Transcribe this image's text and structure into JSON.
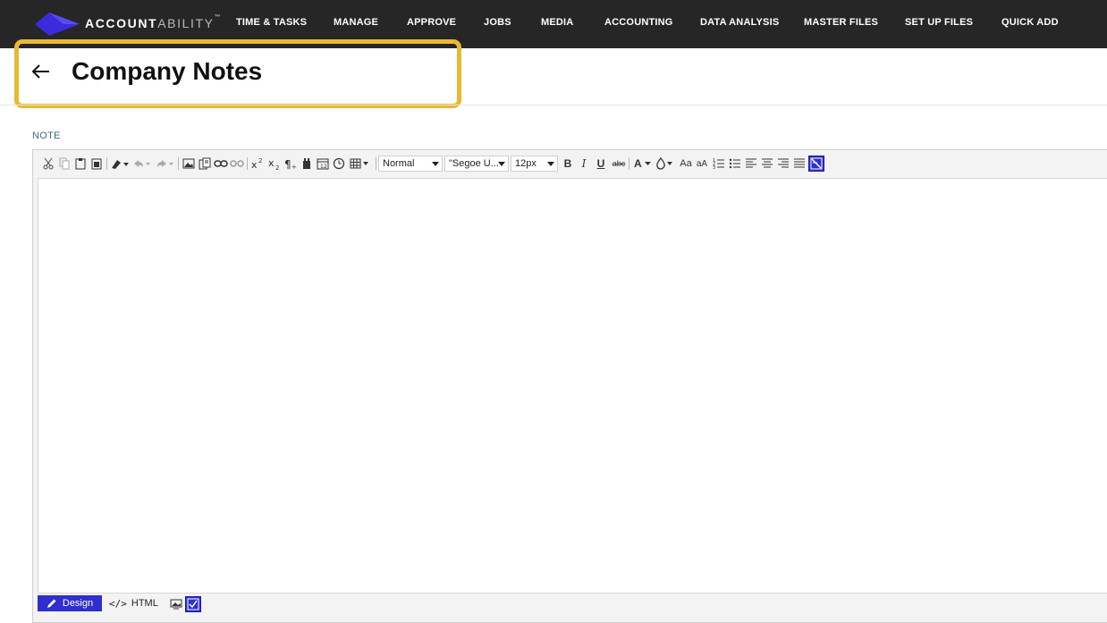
{
  "brand": {
    "bold": "ACCOUNT",
    "light": "ABILITY",
    "tm": "™",
    "accent": "#3b2bdc"
  },
  "nav": {
    "items": [
      "TIME & TASKS",
      "MANAGE",
      "APPROVE",
      "JOBS",
      "MEDIA",
      "ACCOUNTING",
      "DATA ANALYSIS",
      "MASTER FILES",
      "SET UP FILES",
      "QUICK ADD"
    ]
  },
  "header": {
    "title": "Company Notes",
    "back_icon": "arrow-left-icon",
    "highlight_color": "#e8b931"
  },
  "field": {
    "label": "NOTE"
  },
  "editor": {
    "format_value": "Normal",
    "font_value": "\"Segoe U...",
    "size_value": "12px",
    "bold": "B",
    "italic": "I",
    "underline": "U",
    "strike": "abc",
    "font_color": "A",
    "case_upper": "Aa",
    "case_lower": "aA",
    "content": "",
    "modes": {
      "design": "Design",
      "html": "HTML"
    }
  }
}
